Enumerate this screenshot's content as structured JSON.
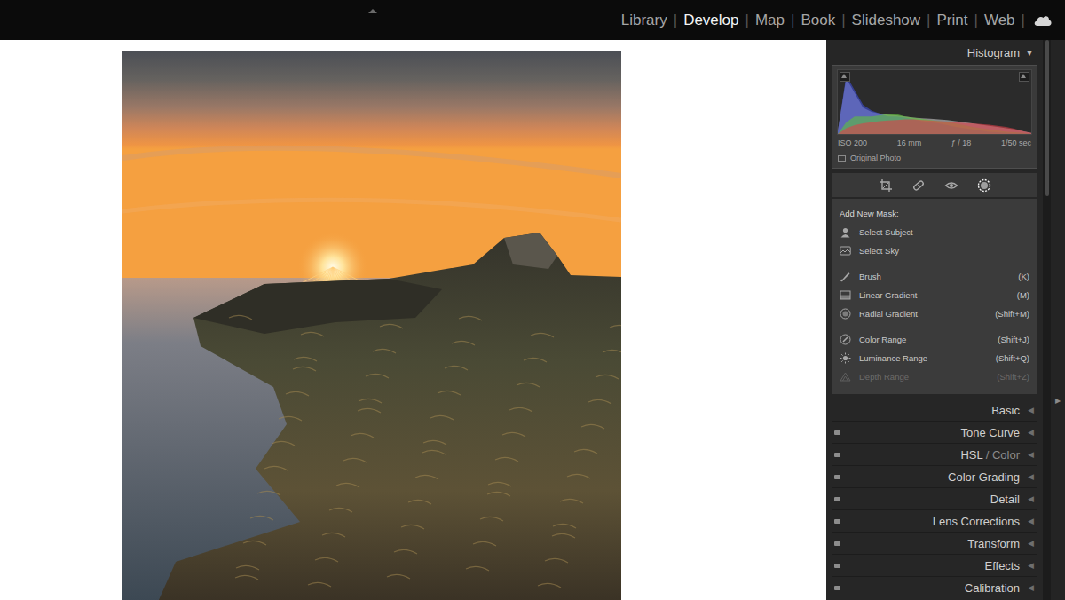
{
  "menu": {
    "modules": [
      {
        "label": "Library",
        "selected": false
      },
      {
        "label": "Develop",
        "selected": true
      },
      {
        "label": "Map",
        "selected": false
      },
      {
        "label": "Book",
        "selected": false
      },
      {
        "label": "Slideshow",
        "selected": false
      },
      {
        "label": "Print",
        "selected": false
      },
      {
        "label": "Web",
        "selected": false
      }
    ],
    "separator": "|"
  },
  "histogram": {
    "title": "Histogram",
    "toggle": "▼",
    "series": [
      {
        "name": "luminance",
        "color": "#9a9a9a",
        "values": [
          0.05,
          0.95,
          0.7,
          0.45,
          0.38,
          0.35,
          0.33,
          0.32,
          0.3,
          0.28,
          0.27,
          0.26,
          0.25,
          0.24,
          0.22,
          0.2,
          0.18,
          0.16,
          0.14,
          0.12,
          0.1,
          0.08,
          0.05,
          0.02
        ]
      },
      {
        "name": "blue",
        "color": "#3f4fd8",
        "values": [
          0.05,
          1.0,
          0.75,
          0.5,
          0.4,
          0.35,
          0.3,
          0.3,
          0.28,
          0.25,
          0.22,
          0.2,
          0.18,
          0.15,
          0.12,
          0.1,
          0.08,
          0.06,
          0.04,
          0.03,
          0.02,
          0.01,
          0.01,
          0
        ]
      },
      {
        "name": "green",
        "color": "#5fbf3a",
        "values": [
          0,
          0.2,
          0.3,
          0.3,
          0.3,
          0.32,
          0.35,
          0.34,
          0.3,
          0.28,
          0.26,
          0.24,
          0.22,
          0.2,
          0.18,
          0.15,
          0.12,
          0.1,
          0.08,
          0.06,
          0.04,
          0.03,
          0.02,
          0
        ]
      },
      {
        "name": "red",
        "color": "#e0404a",
        "values": [
          0,
          0.1,
          0.15,
          0.18,
          0.2,
          0.22,
          0.23,
          0.24,
          0.25,
          0.25,
          0.24,
          0.23,
          0.22,
          0.21,
          0.2,
          0.19,
          0.18,
          0.17,
          0.16,
          0.14,
          0.12,
          0.09,
          0.05,
          0.02
        ]
      }
    ],
    "info": [
      "ISO 200",
      "16 mm",
      "ƒ / 18",
      "1/50 sec"
    ],
    "original_photo": {
      "label": "Original Photo",
      "checked": false
    }
  },
  "tools": [
    {
      "kind": "crop",
      "selected": false
    },
    {
      "kind": "heal",
      "selected": false
    },
    {
      "kind": "redeye",
      "selected": false
    },
    {
      "kind": "mask",
      "selected": true
    }
  ],
  "masks": {
    "heading": "Add New Mask:",
    "groups": [
      [
        {
          "label": "Select Subject",
          "kind": "subject",
          "disabled": false
        },
        {
          "label": "Select Sky",
          "kind": "sky",
          "disabled": false
        }
      ],
      [
        {
          "label": "Brush",
          "shortcut": "(K)",
          "kind": "brush",
          "disabled": false
        },
        {
          "label": "Linear Gradient",
          "shortcut": "(M)",
          "kind": "linear",
          "disabled": false
        },
        {
          "label": "Radial Gradient",
          "shortcut": "(Shift+M)",
          "kind": "radial",
          "disabled": false
        }
      ],
      [
        {
          "label": "Color Range",
          "shortcut": "(Shift+J)",
          "kind": "color",
          "disabled": false
        },
        {
          "label": "Luminance Range",
          "shortcut": "(Shift+Q)",
          "kind": "luminance",
          "disabled": false
        },
        {
          "label": "Depth Range",
          "shortcut": "(Shift+Z)",
          "kind": "depth",
          "disabled": true
        }
      ]
    ]
  },
  "panels": {
    "arrow": "◀",
    "items": [
      {
        "label": "Basic",
        "kind": "plain"
      },
      {
        "label": "Tone Curve",
        "kind": "switch"
      },
      {
        "label": "HSL",
        "sublabel": "/ Color",
        "kind": "switch"
      },
      {
        "label": "Color Grading",
        "kind": "switch"
      },
      {
        "label": "Detail",
        "kind": "switch"
      },
      {
        "label": "Lens Corrections",
        "kind": "switch"
      },
      {
        "label": "Transform",
        "kind": "switch"
      },
      {
        "label": "Effects",
        "kind": "switch"
      },
      {
        "label": "Calibration",
        "kind": "switch"
      }
    ]
  },
  "edge_toggle": "▶"
}
